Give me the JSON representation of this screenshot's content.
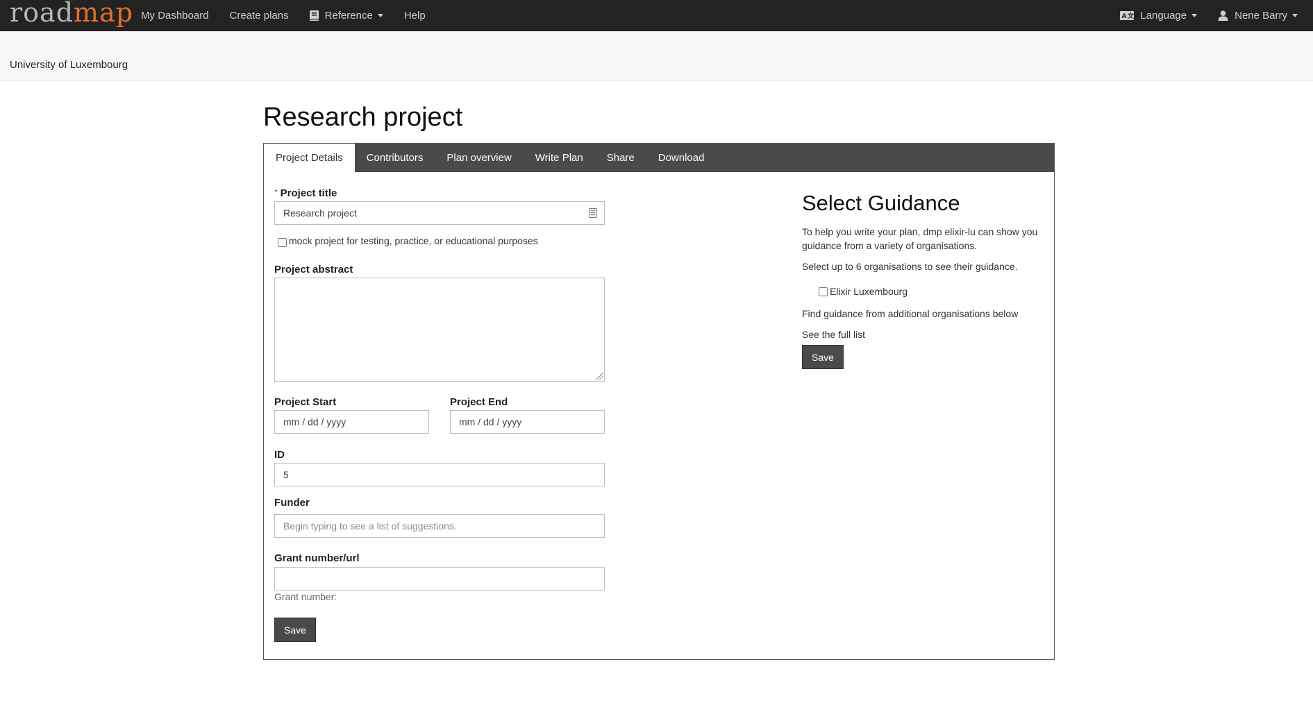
{
  "navbar": {
    "logo_part1": "road",
    "logo_part2": "map",
    "items": [
      {
        "label": "My Dashboard"
      },
      {
        "label": "Create plans"
      },
      {
        "label": "Reference"
      },
      {
        "label": "Help"
      }
    ],
    "language_label": "Language",
    "user_label": "Nene Barry"
  },
  "org": {
    "name": "University of Luxembourg"
  },
  "page": {
    "title": "Research project"
  },
  "tabs": [
    {
      "label": "Project Details"
    },
    {
      "label": "Contributors"
    },
    {
      "label": "Plan overview"
    },
    {
      "label": "Write Plan"
    },
    {
      "label": "Share"
    },
    {
      "label": "Download"
    }
  ],
  "form": {
    "required_mark": "*",
    "title_label": "Project title",
    "title_value": "Research project",
    "mock_label": "mock project for testing, practice, or educational purposes",
    "abstract_label": "Project abstract",
    "start_label": "Project Start",
    "end_label": "Project End",
    "date_placeholder": "mm / dd / yyyy",
    "id_label": "ID",
    "id_value": "5",
    "funder_label": "Funder",
    "funder_placeholder": "Begin typing to see a list of suggestions.",
    "grant_label": "Grant number/url",
    "grant_value": "",
    "grant_help": "Grant number:",
    "save_label": "Save"
  },
  "guidance": {
    "title": "Select Guidance",
    "intro": "To help you write your plan, dmp elixir-lu can show you guidance from a variety of organisations.",
    "select_text": "Select up to 6 organisations to see their guidance.",
    "org_option": "Elixir Luxembourg",
    "find_text": "Find guidance from additional organisations below",
    "full_list_link": "See the full list",
    "save_label": "Save"
  },
  "colors": {
    "navbar_bg": "#232323",
    "logo_accent": "#e76e2b",
    "tab_bar_bg": "#4a4a4a",
    "button_bg": "#4a4a4a",
    "link": "#1f7bb0"
  },
  "icons": {
    "reference": "book-icon",
    "language": "language-icon",
    "user": "user-icon",
    "title_field": "id-card-icon"
  }
}
